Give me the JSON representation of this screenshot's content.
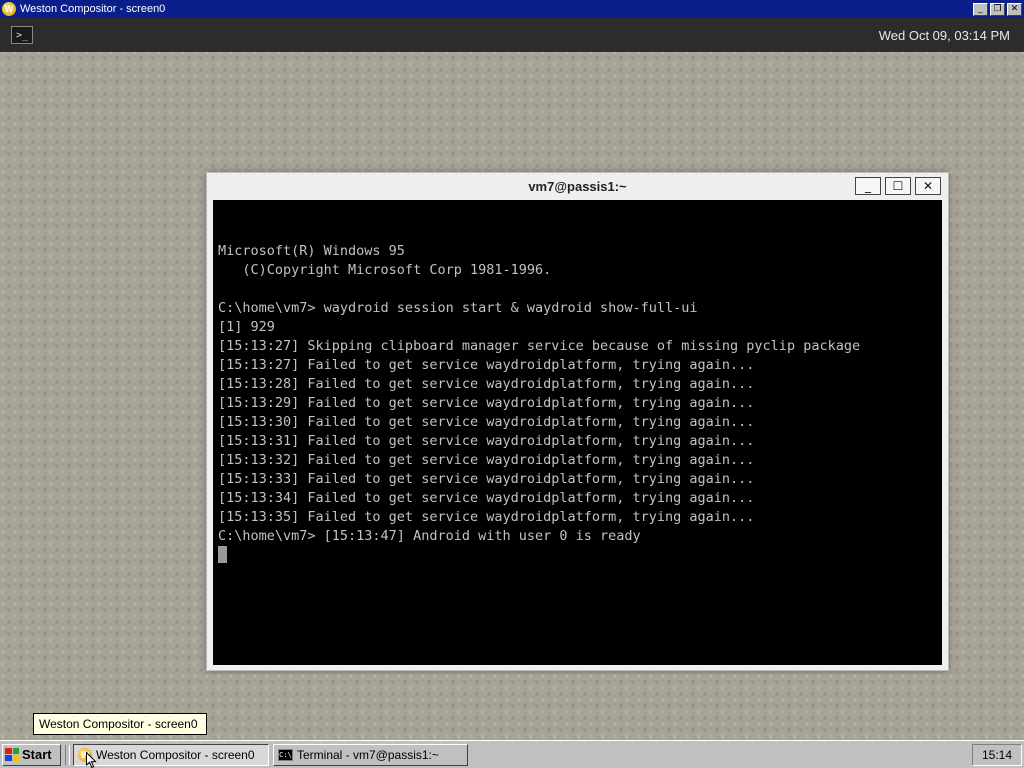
{
  "host_window": {
    "title": "Weston Compositor - screen0",
    "app_icon": "weston-icon",
    "controls": [
      "minimize",
      "restore",
      "close"
    ]
  },
  "weston_panel": {
    "launcher_icon": "terminal-launcher-icon",
    "clock": "Wed Oct 09, 03:14 PM"
  },
  "terminal": {
    "title": "vm7@passis1:~",
    "controls": [
      "minimize",
      "maximize",
      "close"
    ],
    "lines": [
      "Microsoft(R) Windows 95",
      "   (C)Copyright Microsoft Corp 1981-1996.",
      "",
      "C:\\home\\vm7> waydroid session start & waydroid show-full-ui",
      "[1] 929",
      "[15:13:27] Skipping clipboard manager service because of missing pyclip package",
      "[15:13:27] Failed to get service waydroidplatform, trying again...",
      "[15:13:28] Failed to get service waydroidplatform, trying again...",
      "[15:13:29] Failed to get service waydroidplatform, trying again...",
      "[15:13:30] Failed to get service waydroidplatform, trying again...",
      "[15:13:31] Failed to get service waydroidplatform, trying again...",
      "[15:13:32] Failed to get service waydroidplatform, trying again...",
      "[15:13:33] Failed to get service waydroidplatform, trying again...",
      "[15:13:34] Failed to get service waydroidplatform, trying again...",
      "[15:13:35] Failed to get service waydroidplatform, trying again...",
      "C:\\home\\vm7> [15:13:47] Android with user 0 is ready"
    ]
  },
  "tooltip": {
    "text": "Weston Compositor - screen0"
  },
  "taskbar": {
    "start_label": "Start",
    "tasks": [
      {
        "label": "Weston Compositor - screen0",
        "icon": "weston-icon",
        "active": true
      },
      {
        "label": "Terminal - vm7@passis1:~",
        "icon": "terminal-icon",
        "active": false
      }
    ],
    "clock": "15:14"
  },
  "colors": {
    "host_titlebar": "#0a1f8c",
    "weston_panel": "#2c2c2c",
    "terminal_bg": "#000000",
    "terminal_fg": "#c2c2c2",
    "taskbar": "#c0c0c0",
    "tooltip_bg": "#ffffe1"
  }
}
